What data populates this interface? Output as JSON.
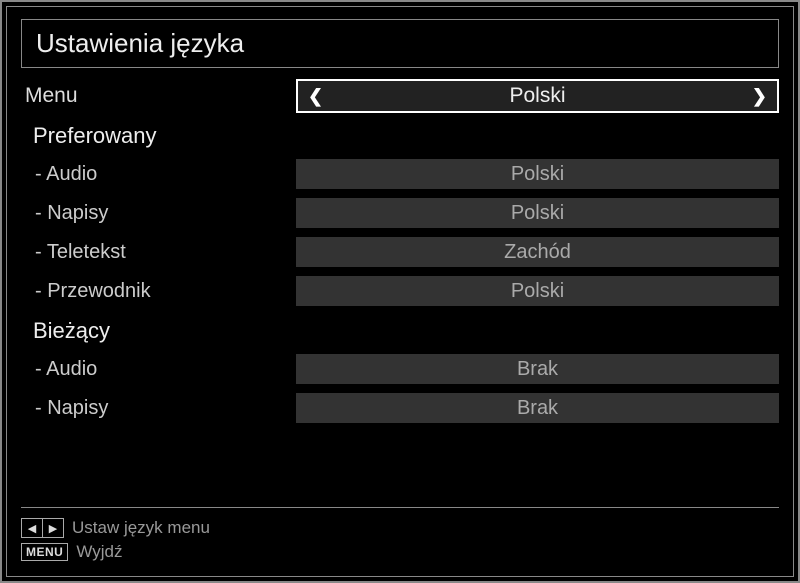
{
  "title": "Ustawienia języka",
  "menu_row": {
    "label": "Menu",
    "value": "Polski"
  },
  "preferred": {
    "header": "Preferowany",
    "items": [
      {
        "label": "- Audio",
        "value": "Polski"
      },
      {
        "label": "- Napisy",
        "value": "Polski"
      },
      {
        "label": "- Teletekst",
        "value": "Zachód"
      },
      {
        "label": "- Przewodnik",
        "value": "Polski"
      }
    ]
  },
  "current": {
    "header": "Bieżący",
    "items": [
      {
        "label": "- Audio",
        "value": "Brak"
      },
      {
        "label": "- Napisy",
        "value": "Brak"
      }
    ]
  },
  "footer": {
    "hint1_key": "◀▶",
    "hint1_text": "Ustaw język menu",
    "hint2_key": "MENU",
    "hint2_text": "Wyjdź"
  }
}
